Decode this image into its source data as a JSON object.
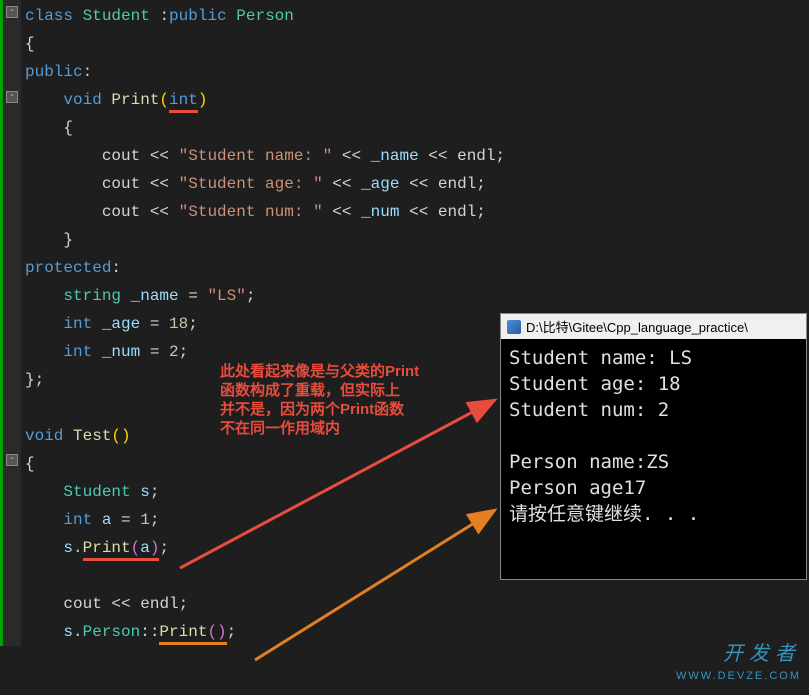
{
  "code": {
    "l1_class": "class",
    "l1_student": " Student ",
    "l1_colon": ":",
    "l1_public": "public",
    "l1_person": " Person",
    "l2": "{",
    "l3_public": "public",
    "l3_colon": ":",
    "l4_void": "    void",
    "l4_print": " Print",
    "l4_int": "int",
    "l5": "    {",
    "l6_cout": "        cout ",
    "l6_op1": "<< ",
    "l6_str": "\"Student name: \"",
    "l6_op2": " << ",
    "l6_var": "_name",
    "l6_op3": " << ",
    "l6_endl": "endl",
    "l6_semi": ";",
    "l7_cout": "        cout ",
    "l7_str": "\"Student age: \"",
    "l7_var": "_age",
    "l8_cout": "        cout ",
    "l8_str": "\"Student num: \"",
    "l8_var": "_num",
    "l9": "    }",
    "l10_protected": "protected",
    "l10_colon": ":",
    "l11_string": "    string",
    "l11_name": " _name ",
    "l11_eq": "= ",
    "l11_val": "\"LS\"",
    "l11_semi": ";",
    "l12_int": "    int",
    "l12_age": " _age ",
    "l12_val": "18",
    "l13_int": "    int",
    "l13_num": " _num ",
    "l13_val": "2",
    "l14": "};",
    "l16_void": "void",
    "l16_test": " Test",
    "l16_paren": "()",
    "l17": "{",
    "l18_student": "    Student",
    "l18_s": " s",
    "l19_int": "    int",
    "l19_a": " a ",
    "l19_val": "1",
    "l20_s": "    s.",
    "l20_print": "Print",
    "l20_a": "a",
    "l22_cout": "    cout ",
    "l22_endl": "endl",
    "l23_s": "    s.",
    "l23_person": "Person",
    "l23_scope": "::",
    "l23_print": "Print",
    "l23_paren": "()"
  },
  "annotation": {
    "line1": "此处看起来像是与父类的Print",
    "line2": "函数构成了重载，但实际上",
    "line3": "并不是，因为两个Print函数",
    "line4": "不在同一作用域内"
  },
  "console": {
    "title": "D:\\比特\\Gitee\\Cpp_language_practice\\",
    "out1": "Student name: LS",
    "out2": "Student age: 18",
    "out3": "Student num: 2",
    "out4": "",
    "out5": "Person name:ZS",
    "out6": "Person age17",
    "out7": "请按任意键继续. . ."
  },
  "watermark": {
    "main": "开发者",
    "sub": "WWW.DEVZE.COM"
  }
}
